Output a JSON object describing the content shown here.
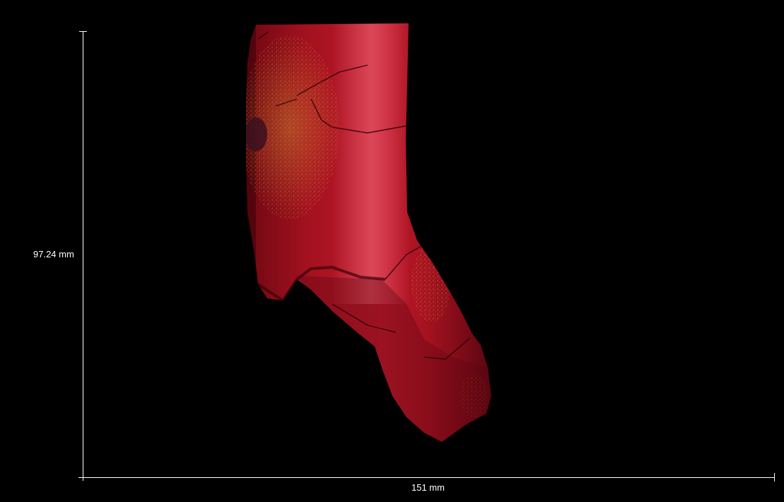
{
  "measurements": {
    "height": "97.24 mm",
    "width": "151 mm"
  },
  "colors": {
    "background": "#000000",
    "ruler": "#ffffff",
    "bone_base": "#a3111f",
    "bone_highlight": "#e84a5c",
    "bone_shadow": "#4a0410",
    "speckle": "#e6b33a"
  }
}
